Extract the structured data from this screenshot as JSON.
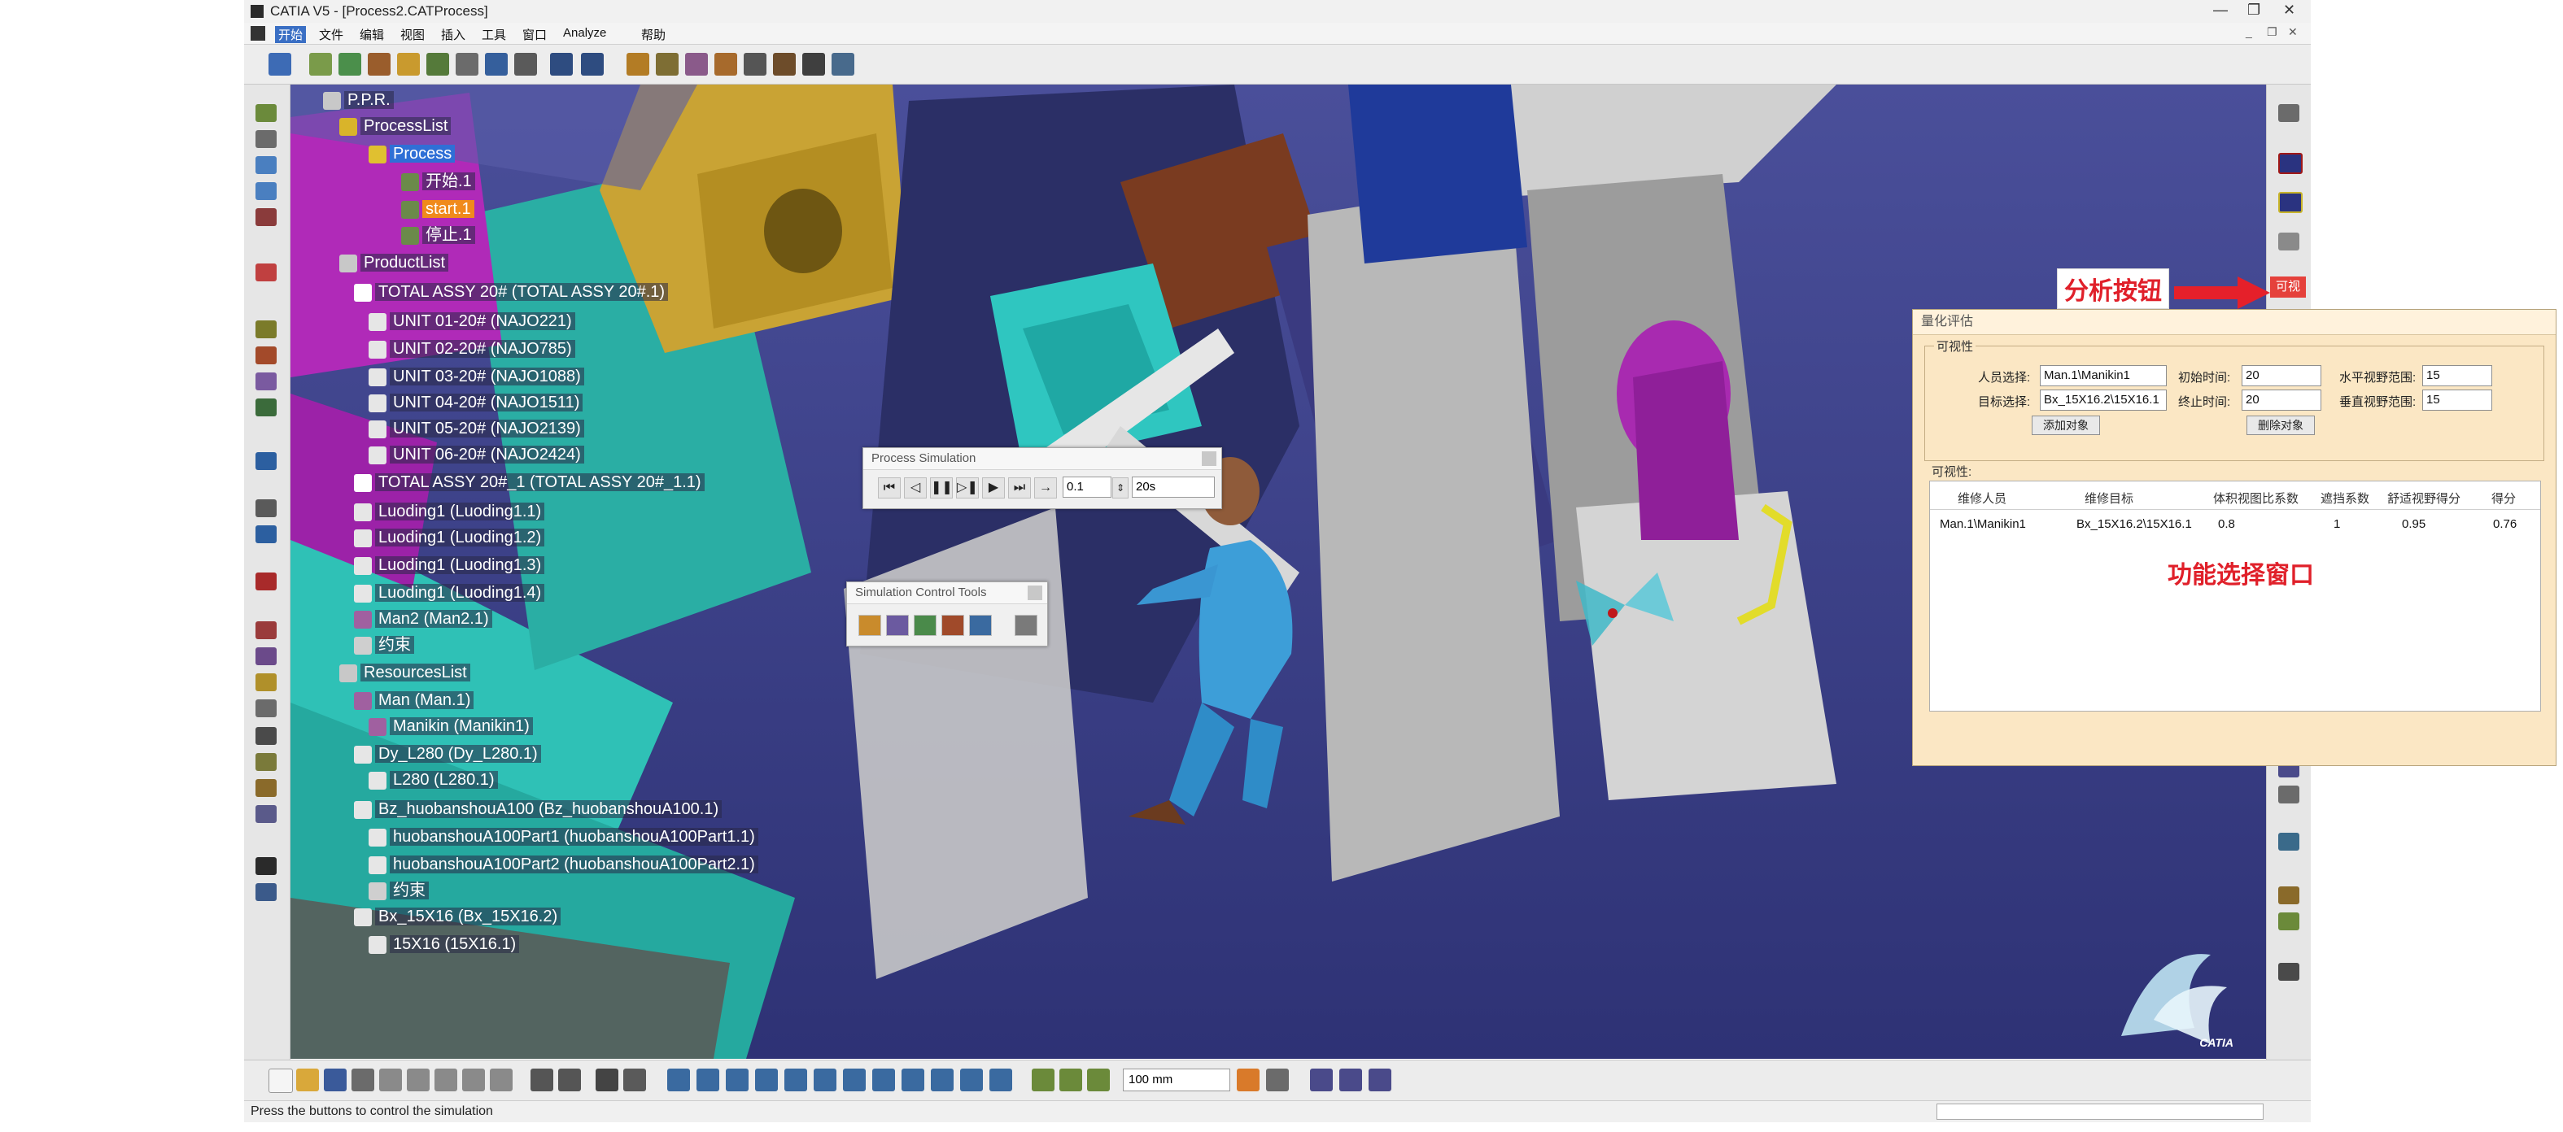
{
  "window": {
    "title": "CATIA V5 - [Process2.CATProcess]"
  },
  "menu": [
    "开始",
    "文件",
    "编辑",
    "视图",
    "插入",
    "工具",
    "窗口",
    "Analyze",
    "帮助"
  ],
  "tree": [
    {
      "label": "P.P.R."
    },
    {
      "label": "ProcessList"
    },
    {
      "label": "Process",
      "selected": true
    },
    {
      "label": "开始.1"
    },
    {
      "label": "start.1",
      "highlight": true
    },
    {
      "label": "停止.1"
    },
    {
      "label": "ProductList"
    },
    {
      "label": "TOTAL ASSY 20# (TOTAL ASSY 20#.1)"
    },
    {
      "label": "UNIT 01-20# (NAJO221)"
    },
    {
      "label": "UNIT 02-20# (NAJO785)"
    },
    {
      "label": "UNIT 03-20# (NAJO1088)"
    },
    {
      "label": "UNIT 04-20# (NAJO1511)"
    },
    {
      "label": "UNIT 05-20# (NAJO2139)"
    },
    {
      "label": "UNIT 06-20# (NAJO2424)"
    },
    {
      "label": "TOTAL ASSY 20#_1 (TOTAL ASSY 20#_1.1)"
    },
    {
      "label": "Luoding1 (Luoding1.1)"
    },
    {
      "label": "Luoding1 (Luoding1.2)"
    },
    {
      "label": "Luoding1 (Luoding1.3)"
    },
    {
      "label": "Luoding1 (Luoding1.4)"
    },
    {
      "label": "Man2 (Man2.1)"
    },
    {
      "label": "约束"
    },
    {
      "label": "ResourcesList"
    },
    {
      "label": "Man (Man.1)"
    },
    {
      "label": "Manikin (Manikin1)"
    },
    {
      "label": "Dy_L280 (Dy_L280.1)"
    },
    {
      "label": "L280 (L280.1)"
    },
    {
      "label": "Bz_huobanshouA100 (Bz_huobanshouA100.1)"
    },
    {
      "label": "huobanshouA100Part1 (huobanshouA100Part1.1)"
    },
    {
      "label": "huobanshouA100Part2 (huobanshouA100Part2.1)"
    },
    {
      "label": "约束"
    },
    {
      "label": "Bx_15X16 (Bx_15X16.2)"
    },
    {
      "label": "15X16 (15X16.1)"
    }
  ],
  "process_sim": {
    "title": "Process Simulation",
    "step": "0.1",
    "time": "20s"
  },
  "sim_tools": {
    "title": "Simulation Control Tools"
  },
  "right_strip": {
    "visual_button": "可视"
  },
  "annotations": {
    "analysis_button": "分析按钮",
    "function_window": "功能选择窗口"
  },
  "panel": {
    "title": "量化评估",
    "group_visibility": "可视性",
    "person_label": "人员选择:",
    "person_value": "Man.1\\Manikin1",
    "target_label": "目标选择:",
    "target_value": "Bx_15X16.2\\15X16.1",
    "init_time_label": "初始时间:",
    "init_time_value": "20",
    "end_time_label": "终止时间:",
    "end_time_value": "20",
    "h_fov_label": "水平视野范围:",
    "h_fov_value": "15",
    "v_fov_label": "垂直视野范围:",
    "v_fov_value": "15",
    "add_button": "添加对象",
    "delete_button": "删除对象",
    "result_group": "可视性:",
    "columns": [
      "维修人员",
      "维修目标",
      "体积视图比系数",
      "遮挡系数",
      "舒适视野得分",
      "得分"
    ],
    "rows": [
      [
        "Man.1\\Manikin1",
        "Bx_15X16.2\\15X16.1",
        "0.8",
        "1",
        "0.95",
        "0.76"
      ]
    ]
  },
  "bottom": {
    "zoom": "100 mm",
    "status": "Press the buttons to control the simulation"
  },
  "logo_text": "CATIA"
}
